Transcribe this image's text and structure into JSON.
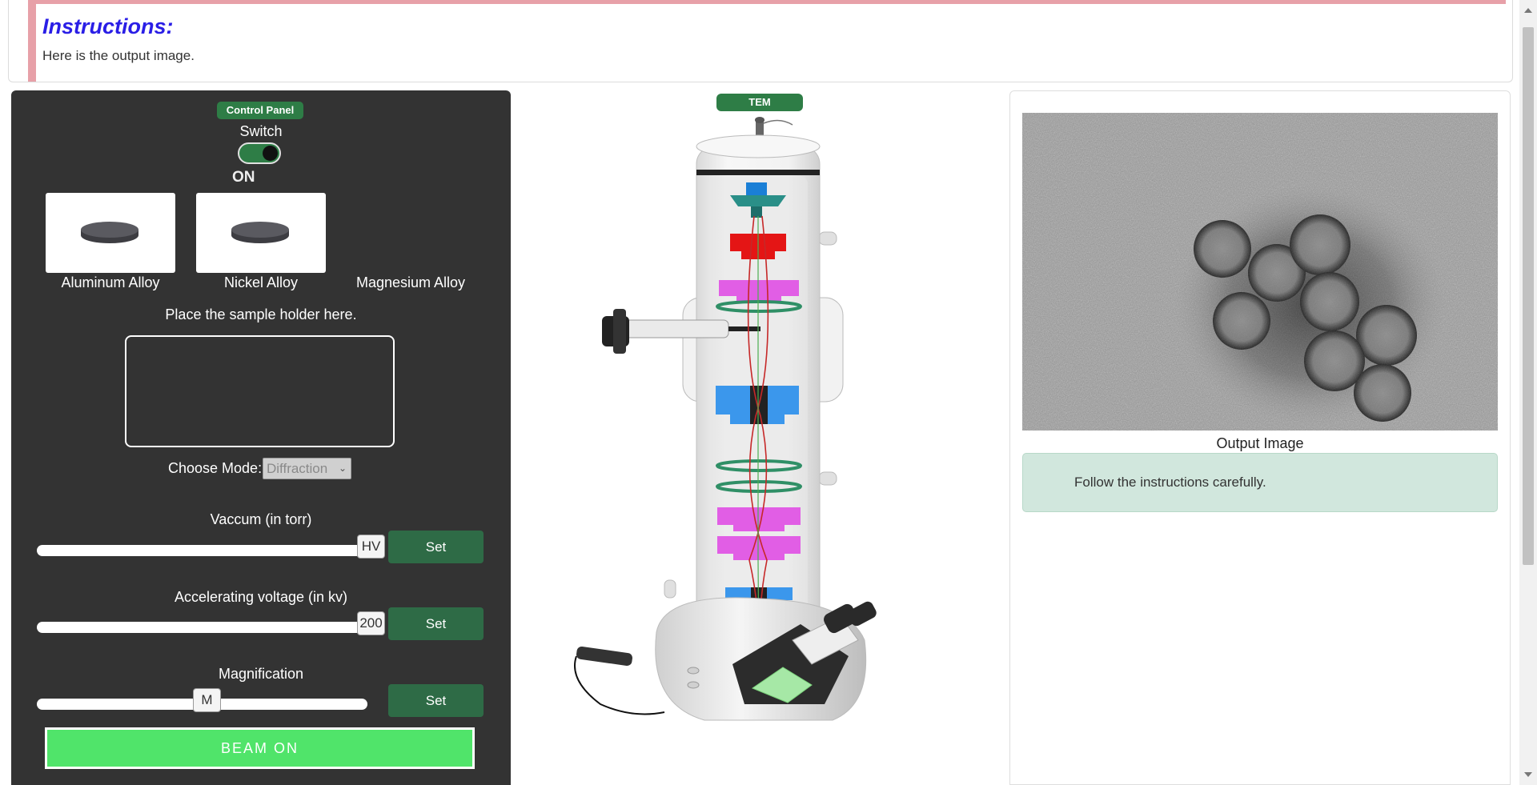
{
  "instructions": {
    "title": "Instructions:",
    "text": "Here is the output image."
  },
  "control_panel": {
    "badge": "Control Panel",
    "switch_label": "Switch",
    "switch_state": "ON",
    "samples": [
      {
        "label": "Aluminum Alloy"
      },
      {
        "label": "Nickel Alloy"
      },
      {
        "label": "Magnesium Alloy"
      }
    ],
    "holder_label": "Place the sample holder here.",
    "mode_label": "Choose Mode:",
    "mode_value": "Diffraction",
    "vacuum": {
      "title": "Vaccum (in torr)",
      "value": "HV",
      "fraction": 1.0,
      "set_label": "Set"
    },
    "voltage": {
      "title": "Accelerating voltage (in kv)",
      "value": "200",
      "fraction": 1.0,
      "set_label": "Set"
    },
    "magnification": {
      "title": "Magnification",
      "value": "M",
      "fraction": 0.5,
      "set_label": "Set"
    },
    "beam_button": "BEAM ON"
  },
  "microscope": {
    "badge": "TEM"
  },
  "output": {
    "caption": "Output Image",
    "alert": "Follow the instructions carefully."
  },
  "colors": {
    "panel_bg": "#333333",
    "accent_green": "#2e7d46",
    "beam_button": "#50e46a",
    "title_blue": "#2a1ee6",
    "alert_bg": "#d1e7dd",
    "instructions_border": "#e7a0a8"
  }
}
